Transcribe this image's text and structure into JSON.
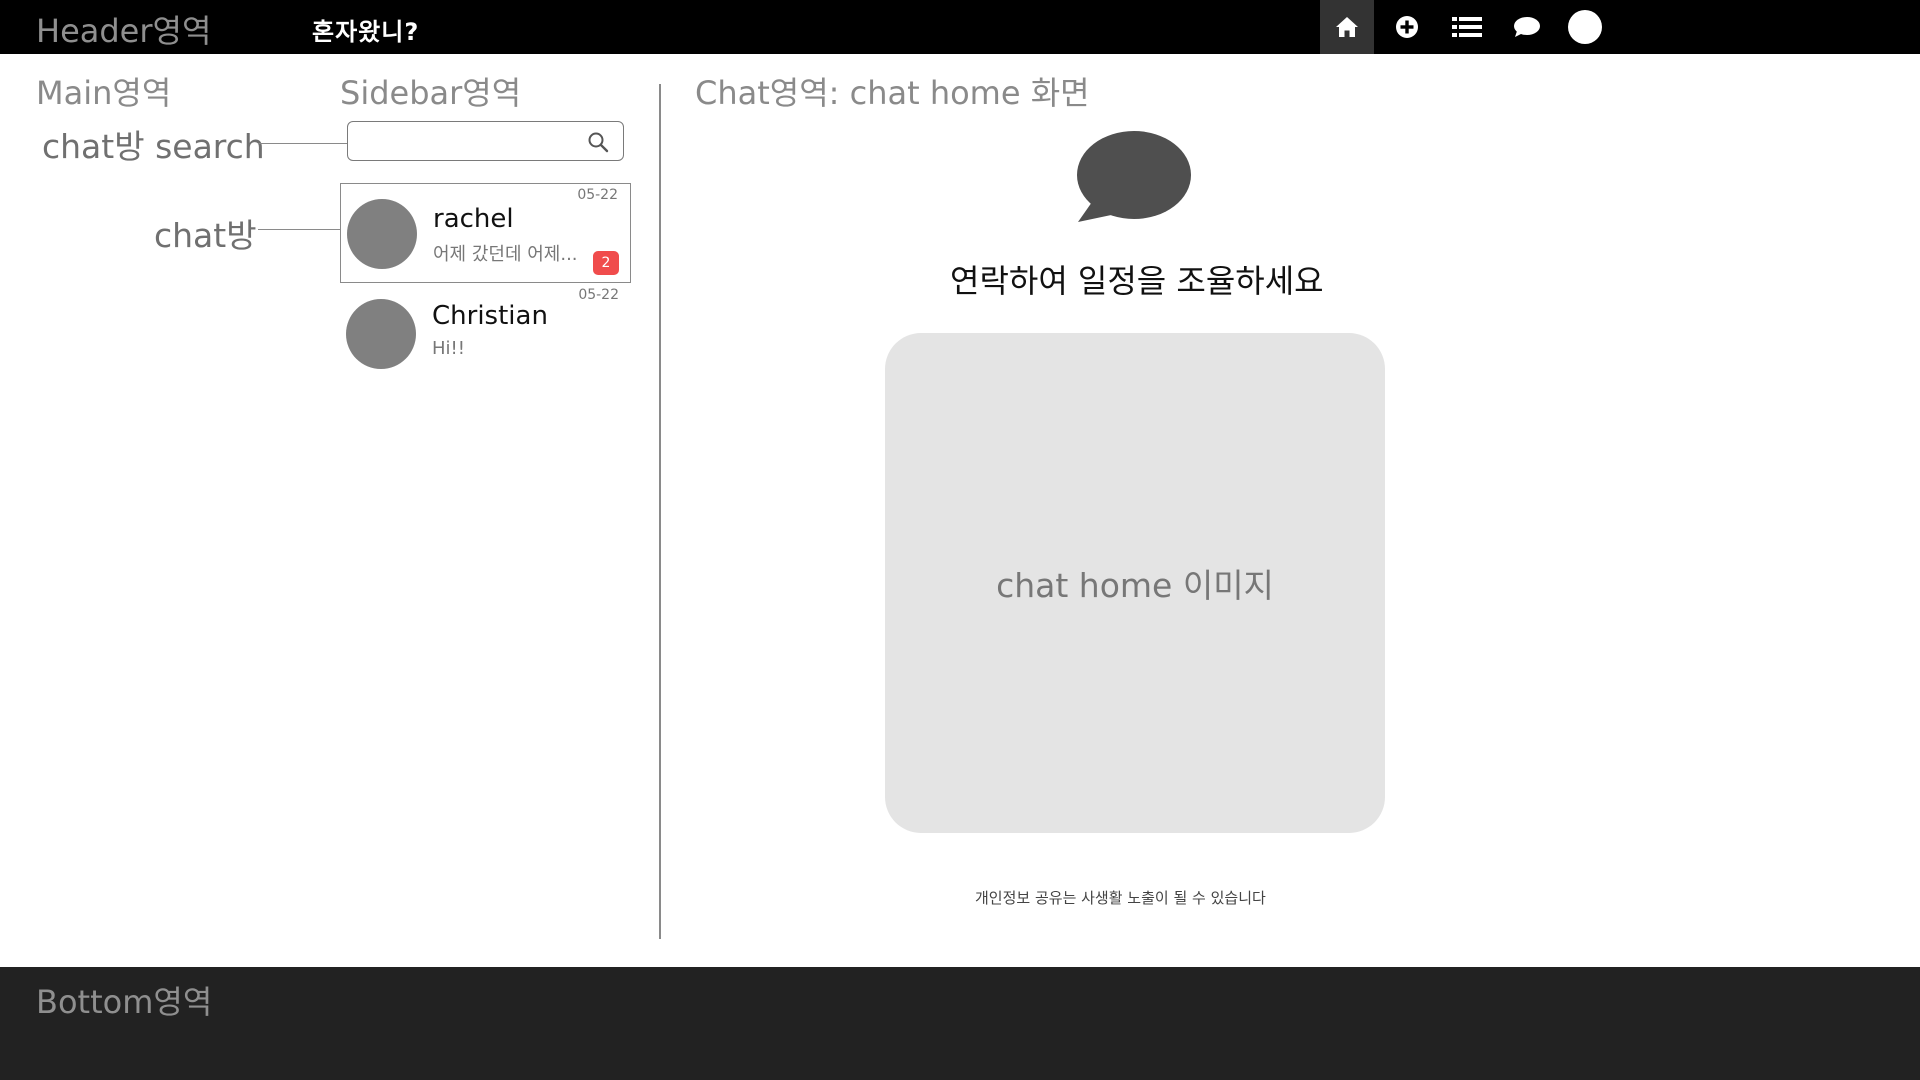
{
  "header": {
    "annotation": "Header영역",
    "brand": "혼자왔니?",
    "nav": [
      {
        "name": "home-icon"
      },
      {
        "name": "plus-circle-icon"
      },
      {
        "name": "list-icon"
      },
      {
        "name": "chat-bubble-icon"
      },
      {
        "name": "profile-avatar"
      }
    ]
  },
  "main": {
    "annotation": "Main영역",
    "search_annotation": "chat방 search",
    "room_annotation": "chat방"
  },
  "sidebar": {
    "annotation": "Sidebar영역",
    "search": {
      "placeholder": "",
      "value": ""
    },
    "rooms": [
      {
        "name": "rachel",
        "message": "어제 갔던데 어제...",
        "date": "05-22",
        "unread": "2",
        "selected": true
      },
      {
        "name": "Christian",
        "message": "Hi!!",
        "date": "05-22",
        "unread": "",
        "selected": false
      }
    ]
  },
  "chat": {
    "annotation": "Chat영역: chat home 화면",
    "headline": "연락하여 일정을 조율하세요",
    "image_label": "chat home 이미지",
    "notice": "개인정보 공유는 사생활 노출이 될 수 있습니다"
  },
  "bottom": {
    "annotation": "Bottom영역"
  },
  "colors": {
    "header_bg": "#000000",
    "bottom_bg": "#222222",
    "badge": "#f04c4c",
    "avatar": "#808080",
    "image_placeholder": "#e4e4e4"
  }
}
